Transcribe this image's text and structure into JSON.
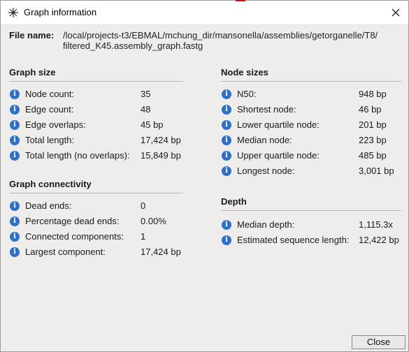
{
  "window": {
    "title": "Graph information"
  },
  "file": {
    "label": "File name:",
    "path_line1": "/local/projects-t3/EBMAL/mchung_dir/mansonella/assemblies/getorganelle/T8/",
    "path_line2": "filtered_K45.assembly_graph.fastg"
  },
  "graph_size": {
    "heading": "Graph size",
    "rows": [
      {
        "label": "Node count:",
        "value": "35"
      },
      {
        "label": "Edge count:",
        "value": "48"
      },
      {
        "label": "Edge overlaps:",
        "value": "45 bp"
      },
      {
        "label": "Total length:",
        "value": "17,424 bp"
      },
      {
        "label": "Total length (no overlaps):",
        "value": "15,849 bp"
      }
    ]
  },
  "graph_connectivity": {
    "heading": "Graph connectivity",
    "rows": [
      {
        "label": "Dead ends:",
        "value": "0"
      },
      {
        "label": "Percentage dead ends:",
        "value": "0.00%"
      },
      {
        "label": "Connected components:",
        "value": "1"
      },
      {
        "label": "Largest component:",
        "value": "17,424 bp"
      }
    ]
  },
  "node_sizes": {
    "heading": "Node sizes",
    "rows": [
      {
        "label": "N50:",
        "value": "948 bp"
      },
      {
        "label": "Shortest node:",
        "value": "46 bp"
      },
      {
        "label": "Lower quartile node:",
        "value": "201 bp"
      },
      {
        "label": "Median node:",
        "value": "223 bp"
      },
      {
        "label": "Upper quartile node:",
        "value": "485 bp"
      },
      {
        "label": "Longest node:",
        "value": "3,001 bp"
      }
    ]
  },
  "depth": {
    "heading": "Depth",
    "rows": [
      {
        "label": "Median depth:",
        "value": "1,115.3x"
      },
      {
        "label": "Estimated sequence length:",
        "value": "12,422 bp"
      }
    ]
  },
  "buttons": {
    "close": "Close"
  },
  "colors": {
    "info_icon": "#2f6fc6",
    "dialog_bg": "#efedeb"
  }
}
